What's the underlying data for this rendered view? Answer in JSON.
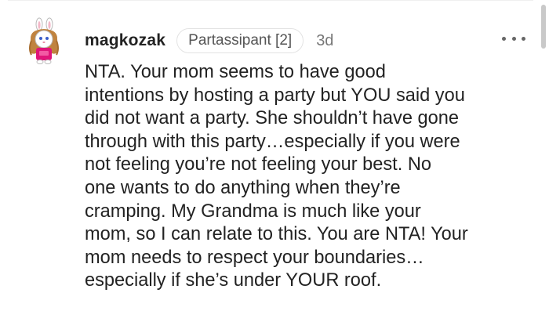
{
  "comment": {
    "username": "magkozak",
    "badge": "Partassipant [2]",
    "time": "3d",
    "body": "NTA. Your mom seems to have good\nintentions by hosting a party but YOU said you\ndid not want a party. She shouldn’t have gone\nthrough with this party…especially if you were\nnot feeling you’re not feeling your best. No\none wants to do anything when they’re\ncramping. My Grandma is much like your\nmom, so I can relate to this. You are NTA! Your\nmom needs to respect your boundaries…\nespecially if she’s under YOUR roof."
  },
  "icons": {
    "avatar": "bunny-avatar-icon",
    "more": "more-options-icon"
  },
  "colors": {
    "text": "#222222",
    "muted": "#777777",
    "badge_border": "#e3e3e3",
    "avatar_dress": "#e0157a",
    "avatar_hair": "#c0833f"
  }
}
